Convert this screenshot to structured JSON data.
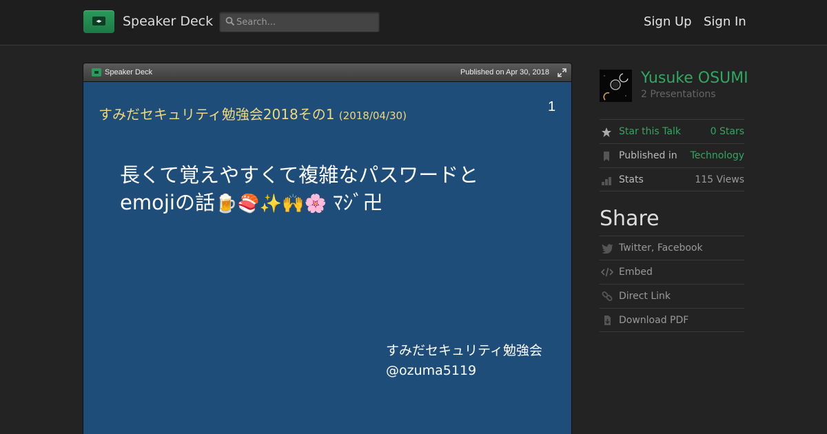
{
  "header": {
    "brand": "Speaker Deck",
    "search_placeholder": "Search...",
    "sign_up": "Sign Up",
    "sign_in": "Sign In"
  },
  "player": {
    "brand": "Speaker Deck",
    "published": "Published on Apr 30, 2018",
    "slide": {
      "title": "すみだセキュリティ勉強会2018その1",
      "title_date": "(2018/04/30)",
      "page_number": "1",
      "main_line1": "長くて覚えやすくて複雑なパスワードと",
      "main_line2_text": "emojiの話",
      "main_line2_emoji": "🍺🍣✨🙌🌸",
      "main_line2_suffix": " ﾏｼﾞ卍",
      "footer_line1": "すみだセキュリティ勉強会",
      "footer_line2": "@ozuma5119"
    }
  },
  "author": {
    "name": "Yusuke OSUMI",
    "presentations": "2 Presentations"
  },
  "info": {
    "star_label": "Star this Talk",
    "star_value": "0 Stars",
    "published_label": "Published in",
    "published_value": "Technology",
    "stats_label": "Stats",
    "stats_value": "115 Views"
  },
  "share": {
    "title": "Share",
    "items": [
      "Twitter, Facebook",
      "Embed",
      "Direct Link",
      "Download PDF"
    ]
  },
  "colors": {
    "background": "#232323",
    "accent_green": "#2fa860",
    "slide_bg": "#1e4d7a",
    "slide_title": "#f0d878"
  }
}
